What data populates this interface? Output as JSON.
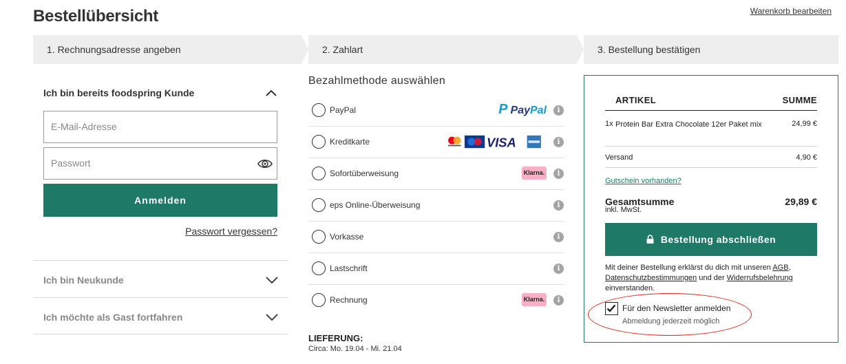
{
  "header": {
    "title": "Bestellübersicht",
    "edit_cart": "Warenkorb bearbeiten"
  },
  "steps": [
    {
      "label": "1. Rechnungsadresse angeben"
    },
    {
      "label": "2. Zahlart"
    },
    {
      "label": "3. Bestellung bestätigen"
    }
  ],
  "login": {
    "heading": "Ich bin bereits foodspring Kunde",
    "email_placeholder": "E-Mail-Adresse",
    "password_placeholder": "Passwort",
    "submit_label": "Anmelden",
    "forgot_label": "Passwort vergessen?"
  },
  "accordion": [
    {
      "label": "Ich bin Neukunde"
    },
    {
      "label": "Ich möchte als Gast fortfahren"
    }
  ],
  "payment": {
    "title": "Bezahlmethode auswählen",
    "methods": [
      {
        "label": "PayPal",
        "logo": "paypal-logo"
      },
      {
        "label": "Kreditkarte",
        "logo": "card-logos"
      },
      {
        "label": "Sofortüberweisung",
        "logo": "Klarna."
      },
      {
        "label": "eps Online-Überweisung",
        "logo": ""
      },
      {
        "label": "Vorkasse",
        "logo": ""
      },
      {
        "label": "Lastschrift",
        "logo": ""
      },
      {
        "label": "Rechnung",
        "logo": "Klarna."
      }
    ],
    "paypal_text_1": "Pay",
    "paypal_text_2": "Pal",
    "visa_text": "VISA",
    "info_glyph": "i"
  },
  "delivery": {
    "title": "LIEFERUNG:",
    "text": "Circa: Mo. 19.04 - Mi. 21.04"
  },
  "summary": {
    "col_article": "ARTIKEL",
    "col_sum": "SUMME",
    "item_qty": "1x",
    "item_name": "Protein Bar Extra Chocolate 12er Paket mix",
    "item_price": "24,99 €",
    "shipping_label": "Versand",
    "shipping_value": "4,90 €",
    "voucher_label": "Gutschein vorhanden?",
    "total_label": "Gesamtsumme",
    "total_sub": "inkl. MwSt.",
    "total_value": "29,89 €",
    "order_button": "Bestellung abschließen",
    "legal_1": "Mit deiner Bestellung erklärst du dich mit unseren ",
    "legal_agb": "AGB",
    "legal_2": ", ",
    "legal_privacy": "Datenschutzbestimmungen",
    "legal_3": " und der ",
    "legal_withdrawal": "Widerrufsbelehrung",
    "legal_4": " einverstanden.",
    "newsletter_label": "Für den Newsletter anmelden",
    "newsletter_sub": "Abmeldung jederzeit möglich",
    "newsletter_checked": true
  },
  "colors": {
    "accent": "#1e7a66",
    "step_bg": "#eeeeee",
    "klarna": "#f7b1c7",
    "highlight": "#e0251b"
  }
}
